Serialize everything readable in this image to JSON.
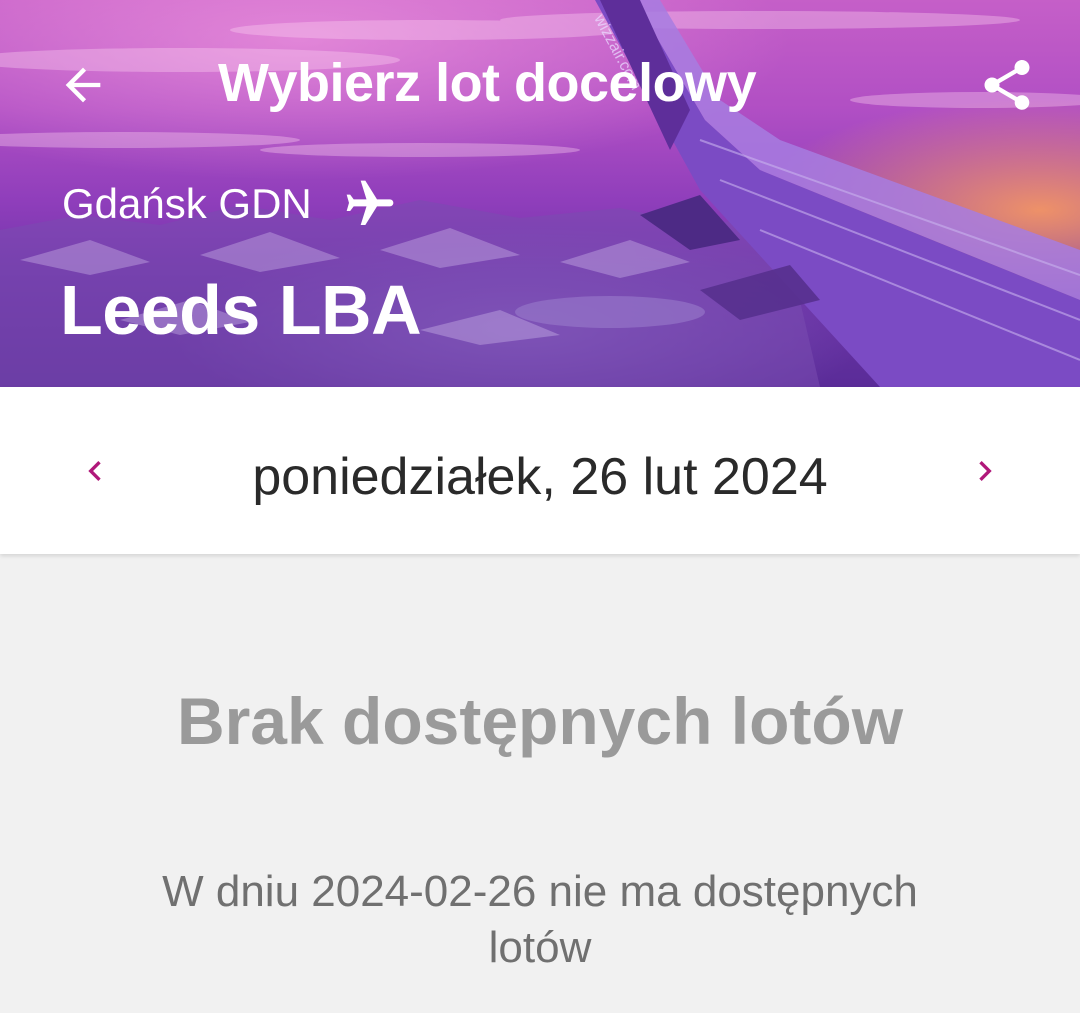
{
  "appbar": {
    "title": "Wybierz lot docelowy",
    "back_icon": "arrow-left-icon",
    "share_icon": "share-icon"
  },
  "hero": {
    "origin": "Gdańsk GDN",
    "origin_icon": "airplane-icon",
    "destination": "Leeds LBA",
    "wing_watermark": "wizzair.com"
  },
  "date_bar": {
    "date": "poniedziałek, 26 lut 2024",
    "prev_icon": "chevron-left-icon",
    "next_icon": "chevron-right-icon"
  },
  "empty_state": {
    "title": "Brak dostępnych lotów",
    "message": "W dniu 2024-02-26 nie ma dostępnych lotów"
  },
  "colors": {
    "accent": "#b0187a",
    "hero_purple": "#8f3ebb",
    "background": "#f1f1f1",
    "muted_title": "#9a9a9a",
    "muted_text": "#707070"
  }
}
